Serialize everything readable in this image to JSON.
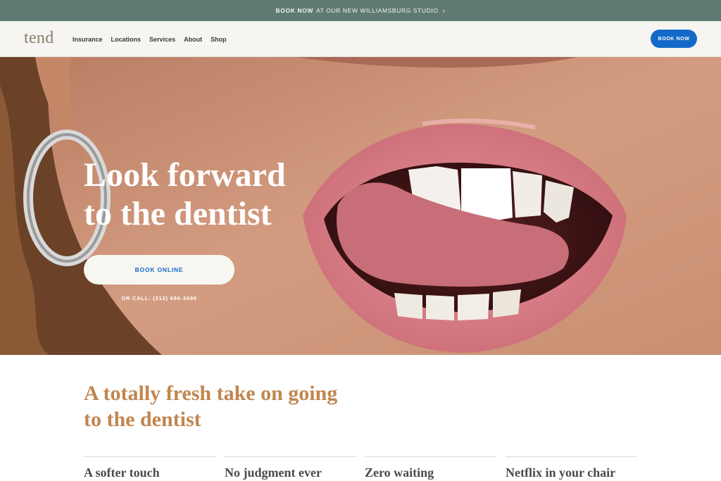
{
  "announcement": {
    "bold": "BOOK NOW",
    "text": "AT OUR NEW WILLIAMSBURG STUDIO",
    "arrow": "›"
  },
  "nav": {
    "logo": "tend",
    "links": [
      "Insurance",
      "Locations",
      "Services",
      "About",
      "Shop"
    ],
    "cta": "BOOK NOW"
  },
  "hero": {
    "title_line1": "Look forward",
    "title_line2": "to the dentist",
    "button": "BOOK ONLINE",
    "call": "OR CALL: (212) 686-3686"
  },
  "section": {
    "title_line1": "A totally fresh take on going",
    "title_line2": "to the dentist"
  },
  "features": [
    "A softer touch",
    "No judgment ever",
    "Zero waiting",
    "Netflix in your chair"
  ],
  "colors": {
    "announce_bg": "#5f7a72",
    "brand_blue": "#1469c8",
    "accent_gold": "#c0864f"
  }
}
